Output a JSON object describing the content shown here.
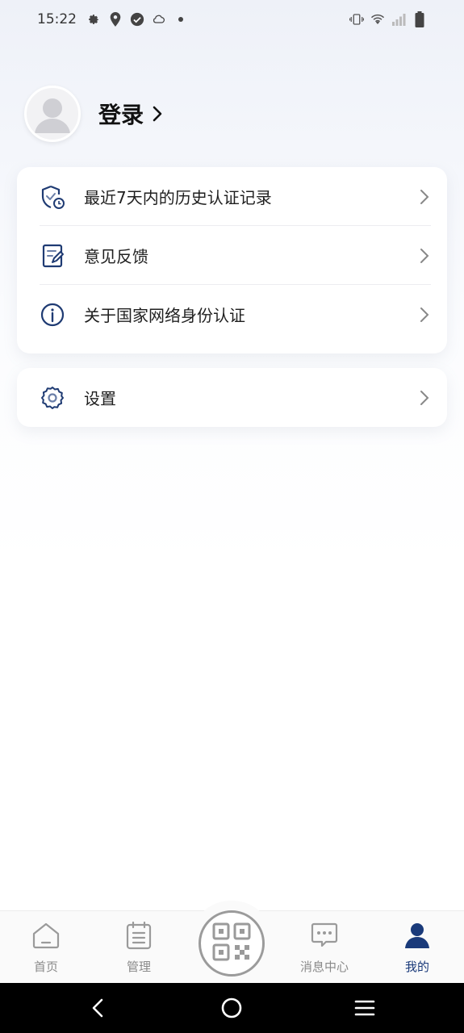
{
  "status_bar": {
    "time": "15:22",
    "left_icons": [
      "gear-icon",
      "location-pin-icon",
      "check-circle-icon",
      "cloud-icon",
      "dot-icon"
    ],
    "right_icons": [
      "vibrate-icon",
      "wifi-icon",
      "signal-icon",
      "battery-icon"
    ]
  },
  "profile": {
    "login_label": "登录"
  },
  "menu_card": {
    "items": [
      {
        "label": "最近7天内的历史认证记录",
        "icon": "shield-check-clock-icon"
      },
      {
        "label": "意见反馈",
        "icon": "feedback-edit-icon"
      },
      {
        "label": "关于国家网络身份认证",
        "icon": "info-circle-icon"
      }
    ]
  },
  "settings_card": {
    "label": "设置",
    "icon": "settings-gear-icon"
  },
  "bottom_nav": {
    "items": [
      {
        "label": "首页",
        "icon": "home-icon",
        "active": false
      },
      {
        "label": "管理",
        "icon": "clipboard-list-icon",
        "active": false
      },
      {
        "label": "消息中心",
        "icon": "chat-bubble-icon",
        "active": false
      },
      {
        "label": "我的",
        "icon": "user-icon",
        "active": true
      }
    ],
    "center_button": "qr-code-icon"
  },
  "colors": {
    "accent": "#1a3a7a",
    "icon_navy": "#1f3b73",
    "inactive": "#8a8a8a"
  }
}
